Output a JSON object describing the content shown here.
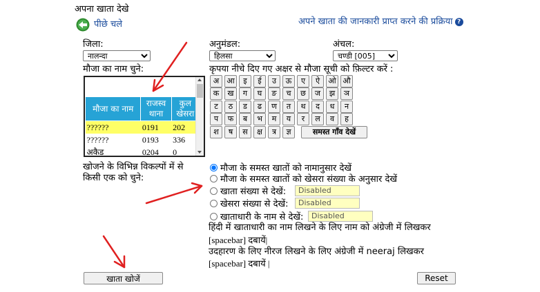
{
  "page_title": "अपना खाता देखे",
  "back_label": "पीछे चले",
  "process_link": "अपने खाता की जानकारी प्राप्त करने की प्रक्रिया",
  "district": {
    "label": "जिला:",
    "value": "नालन्दा"
  },
  "subdivision": {
    "label": "अनुमंडल:",
    "value": "हिलसा"
  },
  "circle": {
    "label": "अंचल:",
    "value": "चण्डी [005]"
  },
  "mauza_label": "मौजा का नाम चुने:",
  "filter_label": "कृपया नीचे दिए गए अक्षर से मौजा सूची को फ़िल्टर करें :",
  "letters_row1": [
    "अ",
    "आ",
    "इ",
    "ई",
    "उ",
    "ऊ",
    "ए",
    "ऐ",
    "ओ",
    "औ"
  ],
  "letters_row2": [
    "क",
    "ख",
    "ग",
    "घ",
    "ङ",
    "च",
    "छ",
    "ज",
    "झ",
    "ञ"
  ],
  "letters_row3": [
    "ट",
    "ठ",
    "ड",
    "ढ",
    "ण",
    "त",
    "थ",
    "द",
    "ध",
    "न"
  ],
  "letters_row4": [
    "प",
    "फ",
    "ब",
    "भ",
    "म",
    "य",
    "र",
    "ल",
    "व",
    "ह"
  ],
  "letters_row5": [
    "श",
    "ष",
    "स",
    "क्ष",
    "त्र",
    "ज्ञ"
  ],
  "all_villages_button": "समस्त गाँव देखें",
  "table": {
    "headers": [
      "मौजा का नाम",
      "राजस्व थाना",
      "कुल खेसरा"
    ],
    "rows": [
      {
        "name": "??????",
        "thana": "0191",
        "khesra": "202"
      },
      {
        "name": "??????",
        "thana": "0193",
        "khesra": "336"
      },
      {
        "name": "अकैड",
        "thana": "0204",
        "khesra": "0"
      }
    ]
  },
  "search_options_label_1": "खोजने के विभिन्न विकल्पों में से",
  "search_options_label_2": "किसी एक को चुने:",
  "options": [
    {
      "label": "मौजा के समस्त खातों को नामानुसार देखें",
      "checked": true
    },
    {
      "label": "मौजा के समस्त खातों को खेसरा संख्या के अनुसार देखें",
      "checked": false
    },
    {
      "label": "खाता संख्या से देखें:",
      "checked": false,
      "field": "Disabled"
    },
    {
      "label": "खेसरा संख्या से देखें:",
      "checked": false,
      "field": "Disabled"
    },
    {
      "label": "खाताधारी के नाम से देखें:",
      "checked": false,
      "field": "Disabled"
    }
  ],
  "hint_line1": "हिंदी में खाताधारी का नाम लिखने के लिए नाम को अंग्रेजी में लिखकर",
  "hint_line2": "[spacebar] दबायें|",
  "hint_line3": "उदहारण के लिए नीरज लिखने के लिए अंग्रेजी में neeraj लिखकर",
  "hint_line4": "[spacebar] दबायें |",
  "search_button": "खाता खोजें",
  "reset_button": "Reset",
  "help_icon_glyph": "?",
  "colors": {
    "link": "#1a4b9c",
    "table_header": "#26a3d6",
    "highlight_row": "#ffff66",
    "arrow": "#e02020",
    "disabled_field": "#ffffc0"
  }
}
